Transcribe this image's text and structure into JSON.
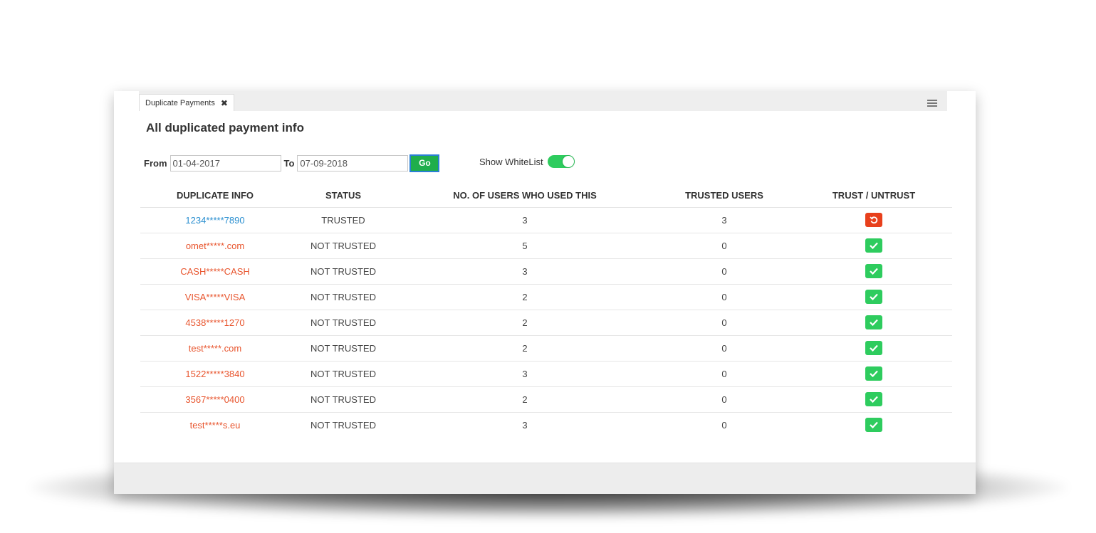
{
  "tab": {
    "label": "Duplicate Payments",
    "close_glyph": "✖"
  },
  "page": {
    "title": "All duplicated payment info"
  },
  "filters": {
    "from_label": "From",
    "from_value": "01-04-2017",
    "to_label": "To",
    "to_value": "07-09-2018",
    "go_label": "Go",
    "whitelist_label": "Show WhiteList",
    "whitelist_on": true
  },
  "table": {
    "headers": [
      "DUPLICATE INFO",
      "STATUS",
      "NO. OF USERS WHO USED THIS",
      "TRUSTED USERS",
      "TRUST / UNTRUST"
    ],
    "rows": [
      {
        "info": "1234*****7890",
        "status": "TRUSTED",
        "users": "3",
        "trusted": "3",
        "action": "untrust"
      },
      {
        "info": "omet*****.com",
        "status": "NOT TRUSTED",
        "users": "5",
        "trusted": "0",
        "action": "trust"
      },
      {
        "info": "CASH*****CASH",
        "status": "NOT TRUSTED",
        "users": "3",
        "trusted": "0",
        "action": "trust"
      },
      {
        "info": "VISA*****VISA",
        "status": "NOT TRUSTED",
        "users": "2",
        "trusted": "0",
        "action": "trust"
      },
      {
        "info": "4538*****1270",
        "status": "NOT TRUSTED",
        "users": "2",
        "trusted": "0",
        "action": "trust"
      },
      {
        "info": "test*****.com",
        "status": "NOT TRUSTED",
        "users": "2",
        "trusted": "0",
        "action": "trust"
      },
      {
        "info": "1522*****3840",
        "status": "NOT TRUSTED",
        "users": "3",
        "trusted": "0",
        "action": "trust"
      },
      {
        "info": "3567*****0400",
        "status": "NOT TRUSTED",
        "users": "2",
        "trusted": "0",
        "action": "trust"
      },
      {
        "info": "test*****s.eu",
        "status": "NOT TRUSTED",
        "users": "3",
        "trusted": "0",
        "action": "trust"
      }
    ]
  },
  "icons": {
    "trust": "check-icon",
    "untrust": "undo-icon",
    "menu": "hamburger-menu-icon"
  },
  "colors": {
    "trusted_link": "#2a8fd0",
    "untrusted_link": "#e8552e",
    "trust_button": "#2ecc5e",
    "untrust_button": "#e8401c",
    "go_button": "#1fae4c"
  }
}
